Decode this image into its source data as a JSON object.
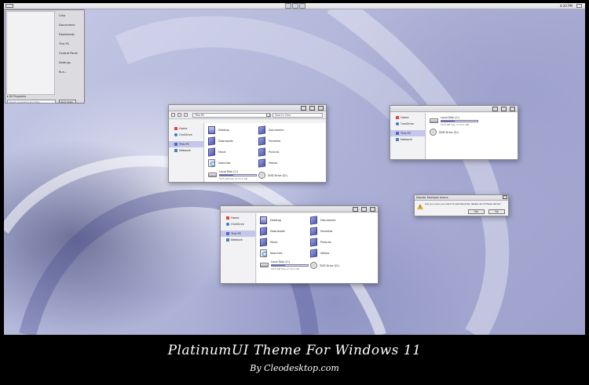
{
  "taskbar": {
    "clock": "4:20 PM",
    "pinned_icons": [
      "explorer-icon",
      "store-icon",
      "settings-icon"
    ]
  },
  "start_menu": {
    "right_items": [
      {
        "label": "Cleo"
      },
      {
        "label": "Documents"
      },
      {
        "label": "Downloads"
      },
      {
        "label": "This PC"
      },
      {
        "label": "Control Panel"
      },
      {
        "label": "Settings"
      },
      {
        "label": "Run..."
      }
    ],
    "all_programs": "All Programs",
    "search_placeholder": "Search programs and files",
    "shutdown": "Shut down"
  },
  "window1": {
    "address": "This PC",
    "search_placeholder": "Search Cleo",
    "nav": [
      {
        "label": "Home"
      },
      {
        "label": "OneDrive"
      },
      {
        "label": "This PC"
      },
      {
        "label": "Network"
      }
    ],
    "items": [
      {
        "label": "Desktop"
      },
      {
        "label": "Documents"
      },
      {
        "label": "Downloads"
      },
      {
        "label": "Favorites"
      },
      {
        "label": "Music"
      },
      {
        "label": "Pictures"
      },
      {
        "label": "Searches"
      },
      {
        "label": "Videos"
      }
    ],
    "drive": {
      "name": "Local Disk (C:)",
      "free": "50.5 GB free of 79.1 GB",
      "used_fraction": 0.36
    },
    "dvd": "DVD Drive (D:)"
  },
  "window2": {
    "nav": [
      {
        "label": "Home"
      },
      {
        "label": "OneDrive"
      },
      {
        "label": "This PC"
      },
      {
        "label": "Network"
      }
    ],
    "drive": {
      "name": "Local Disk (C:)",
      "free": "50.5 GB free of 79.1 GB",
      "used_fraction": 0.36
    },
    "dvd": "DVD Drive (D:)"
  },
  "window3": {
    "nav": [
      {
        "label": "Home"
      },
      {
        "label": "OneDrive"
      },
      {
        "label": "This PC"
      },
      {
        "label": "Network"
      }
    ],
    "items": [
      {
        "label": "Desktop"
      },
      {
        "label": "Documents"
      },
      {
        "label": "Downloads"
      },
      {
        "label": "Favorites"
      },
      {
        "label": "Music"
      },
      {
        "label": "Pictures"
      },
      {
        "label": "Searches"
      },
      {
        "label": "Videos"
      }
    ],
    "drive": {
      "name": "Local Disk (C:)",
      "free": "50.5 GB free of 79.1 GB",
      "used_fraction": 0.36
    },
    "dvd": "DVD Drive (D:)"
  },
  "dialog": {
    "title": "Delete Multiple Items",
    "message": "Are you sure you want to permanently delete all of these items?",
    "yes": "Yes",
    "no": "No"
  },
  "caption": {
    "title": "PlatinumUI Theme For Windows 11",
    "credit": "By Cleodesktop.com"
  },
  "colors": {
    "accent": "#6c70c8",
    "selection": "#c4c6ec",
    "folder": "#4f56ad",
    "warning": "#e8a92c"
  }
}
